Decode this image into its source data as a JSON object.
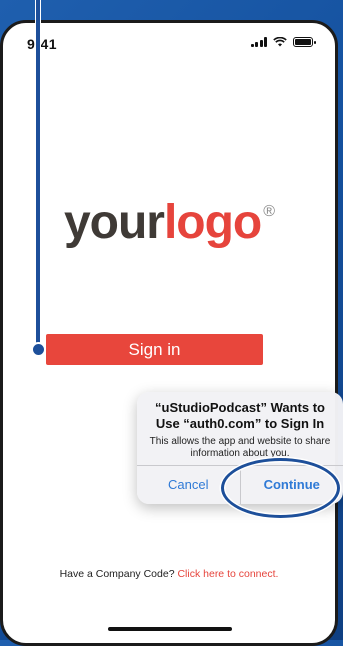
{
  "status_bar": {
    "time": "9:41"
  },
  "logo": {
    "your": "your",
    "mark": "logo",
    "registered": "®"
  },
  "signin": {
    "label": "Sign in"
  },
  "alert": {
    "title": "“uStudioPodcast” Wants to Use “auth0.com” to Sign In",
    "message": "This allows the app and website to share information about you.",
    "cancel_label": "Cancel",
    "continue_label": "Continue"
  },
  "footer": {
    "prompt": "Have a Company Code? ",
    "link": "Click here to connect."
  },
  "colors": {
    "brand_red": "#e8463c",
    "background_blue": "#1552a0",
    "ios_blue": "#2f7ad6"
  }
}
